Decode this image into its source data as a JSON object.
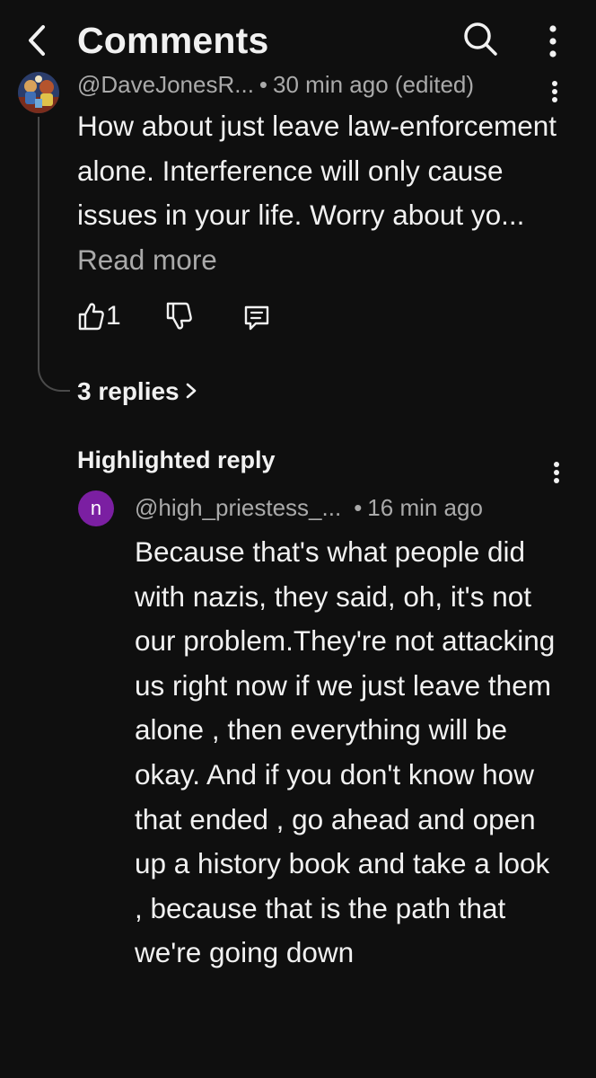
{
  "header": {
    "title": "Comments",
    "icons": [
      "back-icon",
      "search-icon",
      "more-vert-icon"
    ]
  },
  "comment": {
    "author": "@DaveJonesR...",
    "separator": "•",
    "time": "30 min ago (edited)",
    "text": "How about just leave law-enforcement alone. Interference will only cause issues in your life. Worry about yo...",
    "read_more": "Read more",
    "likes": "1",
    "replies_link": "3 replies"
  },
  "highlighted": {
    "label": "Highlighted reply",
    "avatar_letter": "n",
    "avatar_color": "#7b1fa2",
    "author": "@high_priestess_...",
    "separator": "•",
    "time": "16 min ago",
    "text": "Because that's what people did with nazis, they said, oh, it's not our problem.They're not attacking us right now if we just leave them alone , then everything will be okay. And if you don't know how that ended , go ahead and open up a history book and take a look , because that is the path that we're going down"
  },
  "colors": {
    "background": "#0f0f0f",
    "text_primary": "#f1f1f1",
    "text_secondary": "#aaaaaa",
    "thread_line": "#4a4a4a"
  }
}
